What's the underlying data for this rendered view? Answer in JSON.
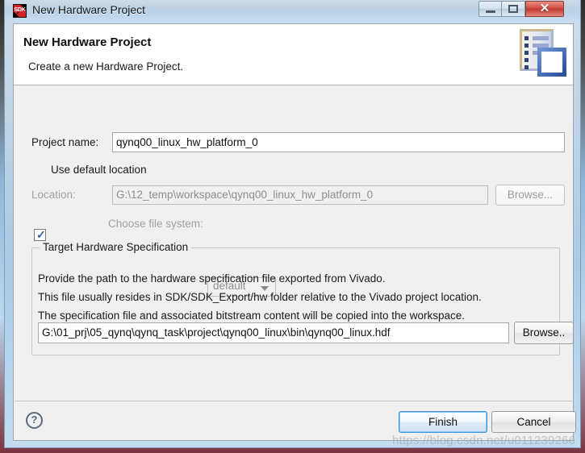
{
  "window": {
    "title": "New Hardware Project",
    "app_icon_text": "SDK",
    "minimize_label": "—",
    "maximize_label": "□",
    "close_label": "✕"
  },
  "header": {
    "title": "New Hardware Project",
    "subtitle": "Create a new Hardware Project.",
    "banner_icon": "document-list-icon"
  },
  "form": {
    "project_name_label": "Project name:",
    "project_name_value": "qynq00_linux_hw_platform_0",
    "use_default_location_label": "Use default location",
    "use_default_location_checked": true,
    "location_label": "Location:",
    "location_value": "G:\\12_temp\\workspace\\qynq00_linux_hw_platform_0",
    "location_browse_label": "Browse...",
    "choose_file_system_label": "Choose file system:",
    "file_system_value": "default"
  },
  "target_group": {
    "title": "Target Hardware Specification",
    "description_lines": [
      "Provide the path to the hardware specification file exported from Vivado.",
      "This file usually resides in SDK/SDK_Export/hw folder relative to the Vivado project location.",
      "The specification file and associated bitstream content will be copied into the workspace."
    ],
    "hdf_path_value": "G:\\01_prj\\05_qynq\\qynq_task\\project\\qynq00_linux\\bin\\qynq00_linux.hdf",
    "hdf_browse_label": "Browse.."
  },
  "footer": {
    "help_label": "?",
    "finish_label": "Finish",
    "cancel_label": "Cancel"
  },
  "watermark": {
    "text": "https://blog.csdn.net/u011239266"
  },
  "colors": {
    "accent_blue": "#3c93d6",
    "titlebar_blue": "#bed2e4",
    "close_red": "#c13a30",
    "dialog_gray": "#f0f0f0"
  }
}
